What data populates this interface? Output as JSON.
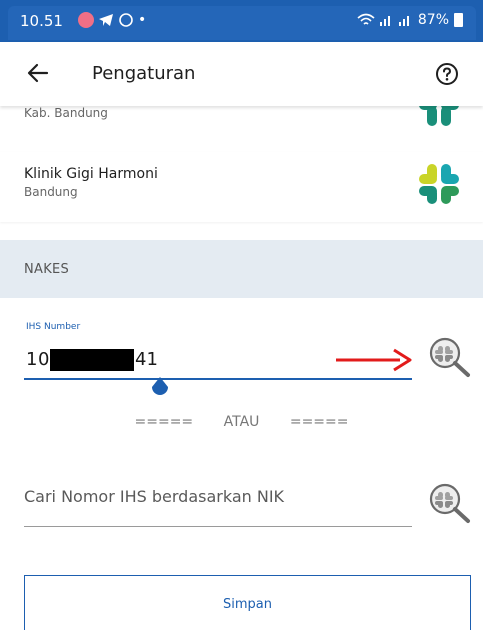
{
  "status_bar": {
    "time": "10.51",
    "signal_glyphs": "᯾ .ıl .ıl",
    "battery": "87%",
    "dot": "•"
  },
  "app_bar": {
    "title": "Pengaturan",
    "back_icon": "arrow-left-icon",
    "help_icon": "help-circle-icon"
  },
  "clinics": [
    {
      "name": "",
      "city": "Kab. Bandung",
      "logo": "satusehat-logo"
    },
    {
      "name": "Klinik Gigi Harmoni",
      "city": "Bandung",
      "logo": "satusehat-logo"
    }
  ],
  "section": {
    "label": "NAKES"
  },
  "ihs_field": {
    "label": "IHS Number",
    "value_prefix": "10",
    "value_suffix": "41"
  },
  "separator": {
    "text": "=====      ATAU      ====="
  },
  "nik_field": {
    "placeholder": "Cari Nomor IHS berdasarkan NIK"
  },
  "save_button": {
    "label": "Simpan"
  },
  "colors": {
    "primary": "#1d5fb0",
    "section_bg": "#e4ebf2",
    "arrow": "#e21b1b"
  }
}
